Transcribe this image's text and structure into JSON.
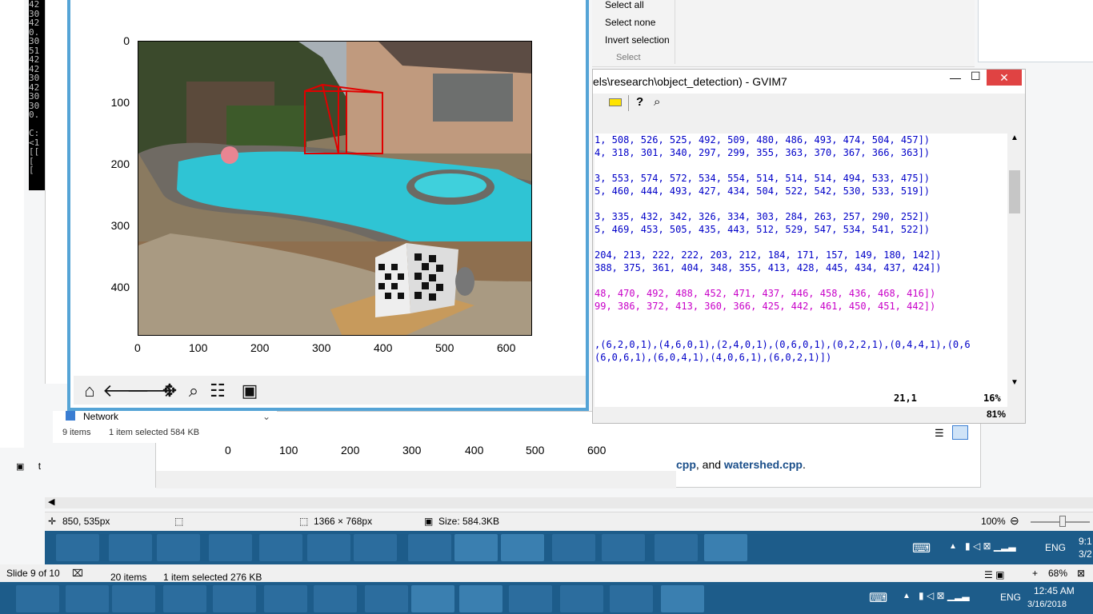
{
  "cmd": {
    "lines": [
      "42",
      "30",
      "42",
      "0.",
      "30",
      "51",
      "42",
      "42",
      "30",
      "42",
      "30",
      "30",
      "0.",
      "",
      "C:",
      "<1",
      "[[",
      "[",
      "["
    ]
  },
  "ribbon": {
    "select_all": "Select all",
    "select_none": "Select none",
    "invert_selection": "Invert selection",
    "group": "Select"
  },
  "vim": {
    "title": "els\\research\\object_detection) - GVIM7",
    "lines": [
      {
        "color": "blue",
        "text": "1, 508, 526, 525, 492, 509, 480, 486, 493, 474, 504, 457])"
      },
      {
        "color": "blue",
        "text": "4, 318, 301, 340, 297, 299, 355, 363, 370, 367, 366, 363])"
      },
      {
        "color": "blue",
        "text": ""
      },
      {
        "color": "blue",
        "text": "3, 553, 574, 572, 534, 554, 514, 514, 514, 494, 533, 475])"
      },
      {
        "color": "blue",
        "text": "5, 460, 444, 493, 427, 434, 504, 522, 542, 530, 533, 519])"
      },
      {
        "color": "blue",
        "text": ""
      },
      {
        "color": "blue",
        "text": "3, 335, 432, 342, 326, 334, 303, 284, 263, 257, 290, 252])"
      },
      {
        "color": "blue",
        "text": "5, 469, 453, 505, 435, 443, 512, 529, 547, 534, 541, 522])"
      },
      {
        "color": "blue",
        "text": ""
      },
      {
        "color": "blue",
        "text": "204, 213, 222, 222, 203, 212, 184, 171, 157, 149, 180, 142])"
      },
      {
        "color": "blue",
        "text": "388, 375, 361, 404, 348, 355, 413, 428, 445, 434, 437, 424])"
      },
      {
        "color": "blue",
        "text": ""
      },
      {
        "color": "mag",
        "text": "48, 470, 492, 488, 452, 471, 437, 446, 458, 436, 468, 416])"
      },
      {
        "color": "mag",
        "text": "99, 386, 372, 413, 360, 366, 425, 442, 461, 450, 451, 442])"
      },
      {
        "color": "blue",
        "text": ""
      },
      {
        "color": "blue",
        "text": ""
      },
      {
        "color": "blue",
        "text": ",(6,2,0,1),(4,6,0,1),(2,4,0,1),(0,6,0,1),(0,2,2,1),(0,4,4,1),(0,6"
      },
      {
        "color": "blue",
        "text": "(6,0,6,1),(6,0,4,1),(4,0,6,1),(6,0,2,1)])"
      }
    ],
    "cursor_pos": "21,1",
    "percent": "16%",
    "zoom": "81%"
  },
  "figure": {
    "y_ticks": [
      "0",
      "100",
      "200",
      "300",
      "400"
    ],
    "x_ticks": [
      "0",
      "100",
      "200",
      "300",
      "400",
      "500",
      "600"
    ]
  },
  "explorer": {
    "network_label": "Network",
    "items": "9 items",
    "selected": "1 item selected  584 KB"
  },
  "bg_doc": {
    "x_ticks": [
      "0",
      "100",
      "200",
      "300",
      "400",
      "500",
      "600"
    ],
    "text_pre": "cpp",
    "text_mid": ", and ",
    "text_link": "watershed.cpp",
    "text_end": "."
  },
  "slide_item": "t",
  "paint_status": {
    "cursor": "850, 535px",
    "dims": "1366 × 768px",
    "size": "Size: 584.3KB",
    "zoom": "100%"
  },
  "ppt_status": {
    "slide": "Slide 9 of 10",
    "items": "20 items",
    "selected": "1 item selected  276 KB",
    "zoom": "68%"
  },
  "tray": {
    "lang": "ENG",
    "time_partial": "9:1",
    "date_partial": "3/2",
    "time": "12:45 AM",
    "date": "3/16/2018"
  }
}
